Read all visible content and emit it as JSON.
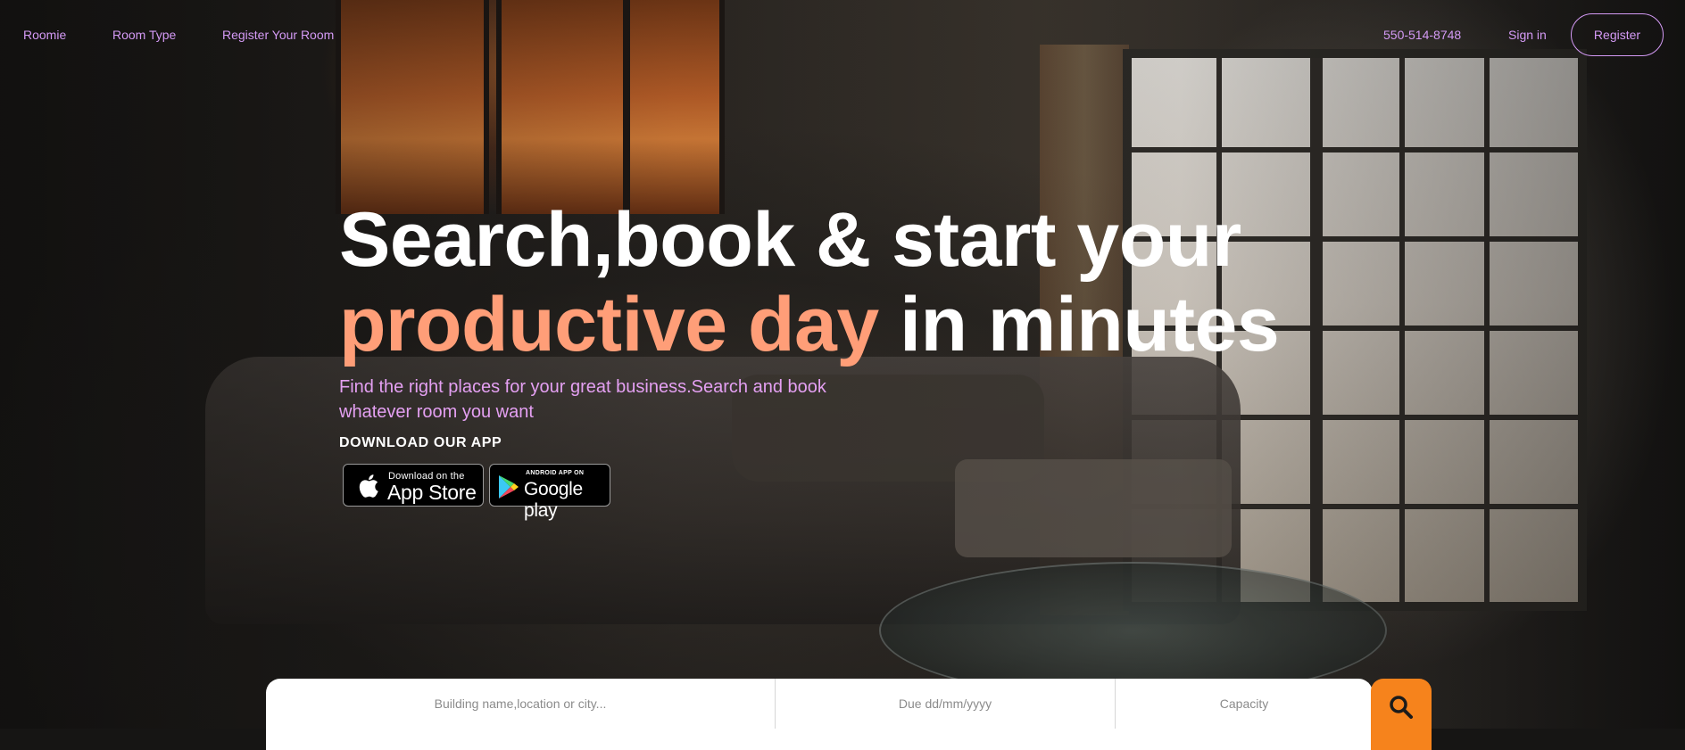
{
  "nav": {
    "brand": "Roomie",
    "room_type": "Room Type",
    "register_room": "Register Your Room",
    "phone": "550-514-8748",
    "sign_in": "Sign in",
    "register": "Register"
  },
  "hero": {
    "line1": "Search,book & start your",
    "accent": "productive day",
    "line2_rest": "in minutes",
    "subtitle": "Find the right places for your great business.Search and book whatever room you want",
    "download_title": "DOWNLOAD OUR APP"
  },
  "stores": {
    "apple_small": "Download on the",
    "apple_big": "App Store",
    "google_small": "ANDROID APP ON",
    "google_big": "Google play"
  },
  "search": {
    "location_placeholder": "Building name,location or city...",
    "date_placeholder": "Due dd/mm/yyyy",
    "capacity_placeholder": "Capacity"
  },
  "colors": {
    "nav_link": "#d49af5",
    "accent_text": "#ff9e78",
    "subtitle": "#e4a0f2",
    "search_button": "#f6831c"
  },
  "icons": {
    "apple": "apple-icon",
    "google_play": "google-play-icon",
    "search": "search-icon"
  }
}
